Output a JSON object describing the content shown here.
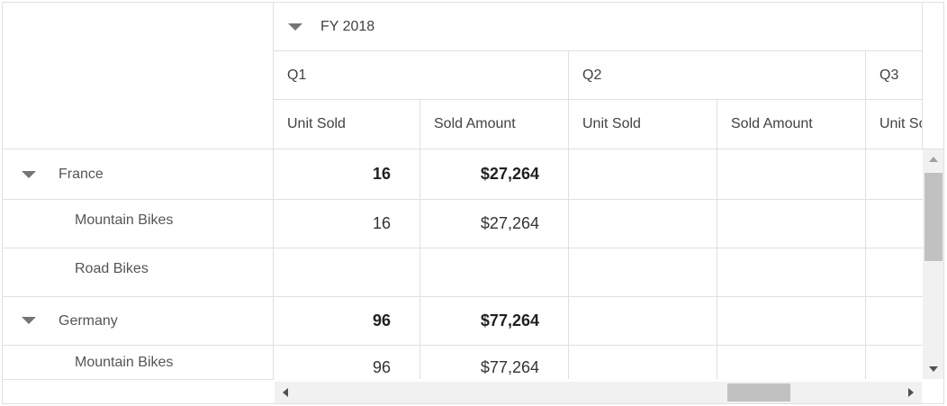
{
  "column_headers": {
    "year": "FY 2018",
    "quarters": [
      "Q1",
      "Q2",
      "Q3"
    ],
    "measures": [
      "Unit Sold",
      "Sold Amount",
      "Unit Sold",
      "Sold Amount",
      "Unit Sold"
    ]
  },
  "rows": [
    {
      "label": "France",
      "expandable": true,
      "values": [
        "16",
        "$27,264",
        "",
        "",
        ""
      ]
    },
    {
      "label": "Mountain Bikes",
      "expandable": false,
      "values": [
        "16",
        "$27,264",
        "",
        "",
        ""
      ]
    },
    {
      "label": "Road Bikes",
      "expandable": false,
      "values": [
        "",
        "",
        "",
        "",
        ""
      ]
    },
    {
      "label": "Germany",
      "expandable": true,
      "values": [
        "96",
        "$77,264",
        "",
        "",
        ""
      ]
    },
    {
      "label": "Mountain Bikes",
      "expandable": false,
      "values": [
        "96",
        "$77,264",
        "",
        "",
        ""
      ]
    }
  ],
  "colors": {
    "grid_line": "#e0e0e0",
    "expander": "#757575",
    "scrollbar_thumb": "#c1c1c1",
    "scrollbar_track": "#f1f1f1"
  }
}
